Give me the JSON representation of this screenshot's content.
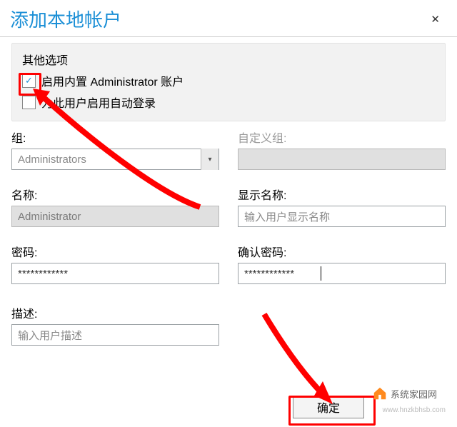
{
  "title": "添加本地帐户",
  "close_glyph": "✕",
  "panel": {
    "label": "其他选项",
    "enable_admin": {
      "label": "启用内置 Administrator 账户",
      "checked": true
    },
    "auto_login": {
      "label": "为此用户启用自动登录",
      "checked": false
    }
  },
  "fields": {
    "group": {
      "label": "组:",
      "value": "Administrators"
    },
    "custom_group": {
      "label": "自定义组:"
    },
    "name": {
      "label": "名称:",
      "value": "Administrator"
    },
    "display_name": {
      "label": "显示名称:",
      "placeholder": "输入用户显示名称"
    },
    "password": {
      "label": "密码:",
      "value": "************"
    },
    "confirm": {
      "label": "确认密码:",
      "value": "************"
    },
    "description": {
      "label": "描述:",
      "placeholder": "输入用户描述"
    }
  },
  "buttons": {
    "ok": "确定"
  },
  "watermark": {
    "text": "系统家园网",
    "url": "www.hnzkbhsb.com"
  }
}
